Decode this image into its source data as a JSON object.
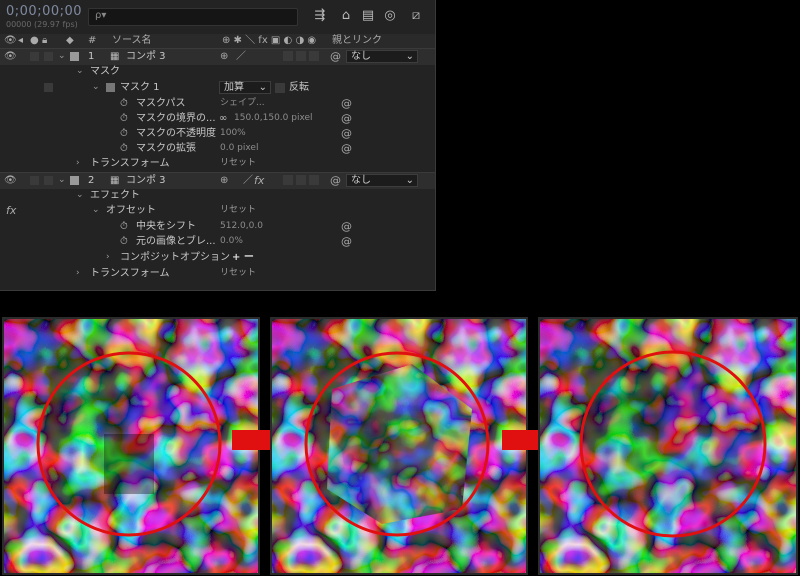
{
  "timeline": {
    "timecode": "0;00;00;00",
    "fps_label": "00000 (29.97 fps)",
    "search_placeholder": "ρ▾",
    "columns": {
      "number": "#",
      "source_name": "ソース名",
      "parent_link": "親とリンク"
    },
    "layers": [
      {
        "number": "1",
        "name": "コンポ 3",
        "parent": "なし",
        "mask_group": "マスク",
        "mask_name": "マスク 1",
        "mask_mode": "加算",
        "mask_invert": "反転",
        "props": [
          {
            "name": "マスクパス",
            "value": "シェイプ..."
          },
          {
            "name": "マスクの境界の...",
            "value": "150.0,150.0 pixel"
          },
          {
            "name": "マスクの不透明度",
            "value": "100%"
          },
          {
            "name": "マスクの拡張",
            "value": "0.0 pixel"
          }
        ],
        "transform": "トランスフォーム",
        "reset": "リセット"
      },
      {
        "number": "2",
        "name": "コンポ 3",
        "parent": "なし",
        "effects_group": "エフェクト",
        "effect_name": "オフセット",
        "effect_reset": "リセット",
        "props": [
          {
            "name": "中央をシフト",
            "value": "512.0,0.0"
          },
          {
            "name": "元の画像とブレ...",
            "value": "0.0%"
          }
        ],
        "composite_options": "コンポジットオプション",
        "composite_value": "+ ー",
        "transform": "トランスフォーム",
        "reset": "リセット"
      }
    ]
  },
  "preview": {
    "accent_red": "#e01010",
    "frames": [
      "before",
      "middle",
      "after"
    ]
  }
}
